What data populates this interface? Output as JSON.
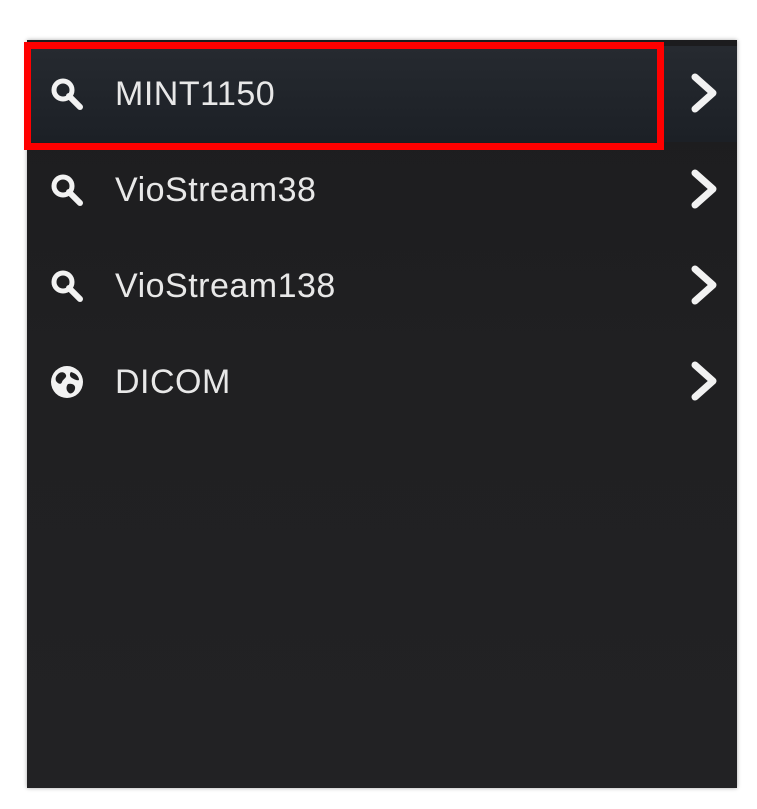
{
  "menu": {
    "items": [
      {
        "label": "MINT1150",
        "icon": "search-icon",
        "selected": true
      },
      {
        "label": "VioStream38",
        "icon": "search-icon",
        "selected": false
      },
      {
        "label": "VioStream138",
        "icon": "search-icon",
        "selected": false
      },
      {
        "label": "DICOM",
        "icon": "globe-icon",
        "selected": false
      }
    ]
  },
  "colors": {
    "panel_background": "#1e1e20",
    "label_text": "#e8e8e8",
    "highlight_border": "#ff0000"
  }
}
